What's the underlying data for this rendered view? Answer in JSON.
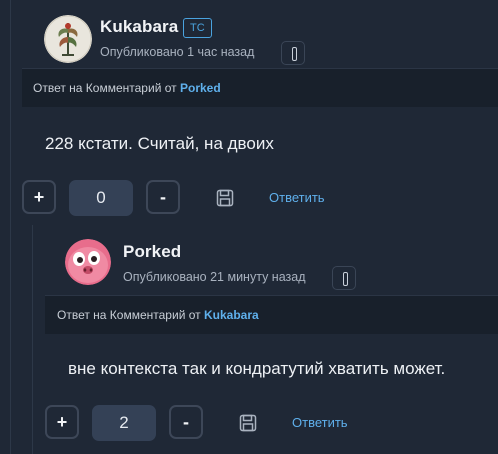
{
  "comments": [
    {
      "author": "Kukabara",
      "badge": "ТС",
      "meta": "Опубликовано 1 час назад",
      "reply_prefix": "Ответ на Комментарий от",
      "reply_to": "Porked",
      "text": "228 кстати. Считай, на двоих",
      "plus": "+",
      "score": "0",
      "minus": "-",
      "reply_label": "Ответить"
    },
    {
      "author": "Porked",
      "meta": "Опубликовано 21 минуту назад",
      "reply_prefix": "Ответ на Комментарий от",
      "reply_to": "Kukabara",
      "text": "вне контекста так и кондратутий хватить может.",
      "plus": "+",
      "score": "2",
      "minus": "-",
      "reply_label": "Ответить"
    }
  ],
  "colors": {
    "background": "#1f2836",
    "accent": "#5fb0ec",
    "reply_strip": "#18202b",
    "score_bg": "#344156"
  },
  "icons": [
    "pin-icon",
    "save-icon"
  ]
}
